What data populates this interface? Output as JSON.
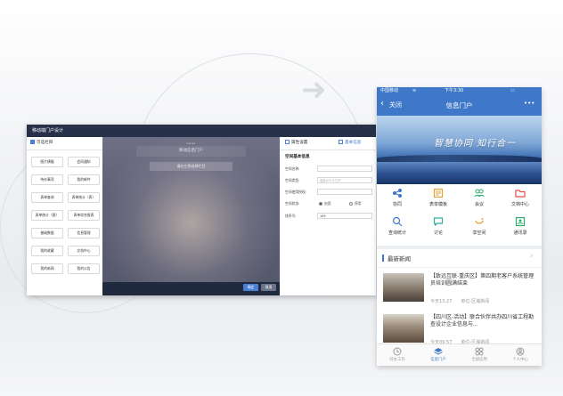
{
  "colors": {
    "accent": "#3f78c8",
    "desktop_title_bar": "#27324a",
    "confirm_button": "#4a7fd6"
  },
  "desktop": {
    "window_title": "移动端门户设计",
    "left_panel": {
      "title": "可选栏目",
      "buttons": [
        "图片横幅",
        "会同通知",
        "待办事项",
        "我的邮件",
        "表单查询",
        "表单统计（表）",
        "表单统计（图）",
        "表单综合报表",
        "基础数据",
        "信息管理",
        "我的收藏",
        "文档中心",
        "我的新闻",
        "我的公告"
      ]
    },
    "preview": {
      "status": "Carrier",
      "title": "移动信息门户",
      "button": "请在左侧选择栏目"
    },
    "footer": {
      "confirm": "确定",
      "cancel": "取消"
    },
    "right_panel": {
      "tab_attrs": "属性设置",
      "tab_base": "基本信息",
      "section_title": "空间基本信息",
      "fields": [
        {
          "label": "空间名称:",
          "value": ""
        },
        {
          "label": "空间类型:",
          "value": "自定义个人门户"
        },
        {
          "label": "空间使用授权:",
          "value": ""
        },
        {
          "label": "空间状态:",
          "value": ""
        },
        {
          "label": "排序号:",
          "value": "109"
        }
      ],
      "status_options": [
        "启用",
        "停用"
      ]
    }
  },
  "mobile": {
    "status_bar": {
      "carrier": "中国移动",
      "signal_icon": "wifi-icon",
      "time": "下午3:30"
    },
    "nav": {
      "back": "关闭",
      "title": "信息门户",
      "more": "•••"
    },
    "banner_slogan": "智慧协同 知行合一",
    "grid": [
      {
        "label": "协同",
        "icon": "share-icon",
        "color": "#3f78c8"
      },
      {
        "label": "表单模板",
        "icon": "form-icon",
        "color": "#e8a23a"
      },
      {
        "label": "会议",
        "icon": "people-icon",
        "color": "#2cae6a"
      },
      {
        "label": "文档中心",
        "icon": "folder-icon",
        "color": "#e04f4f"
      },
      {
        "label": "查询统计",
        "icon": "search-stat-icon",
        "color": "#3f78c8"
      },
      {
        "label": "讨论",
        "icon": "chat-icon",
        "color": "#2cae9e"
      },
      {
        "label": "享空间",
        "icon": "smile-icon",
        "color": "#e8a23a"
      },
      {
        "label": "通讯录",
        "icon": "contacts-icon",
        "color": "#2cae6a"
      }
    ],
    "news_header": "最新新闻",
    "news": [
      {
        "title": "【致远互联-重庆区】第四期老客户系统管理员培训圆满结束",
        "time": "今天13:27",
        "dept": "单位-区域新闻"
      },
      {
        "title": "【四川区-活动】联合伙伴共办四川省工程勘查设计企业信息与...",
        "time": "今天09:57",
        "dept": "单位-区域新闻"
      }
    ],
    "tabbar": [
      {
        "label": "待办工作",
        "icon": "todo-icon"
      },
      {
        "label": "信息门户",
        "icon": "layers-icon"
      },
      {
        "label": "全部应用",
        "icon": "apps-icon"
      },
      {
        "label": "个人中心",
        "icon": "user-icon"
      }
    ]
  }
}
